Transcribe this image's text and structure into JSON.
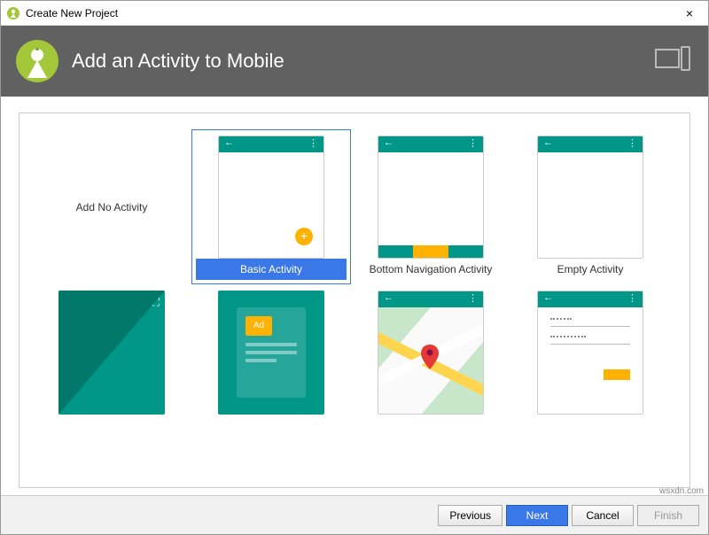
{
  "window": {
    "title": "Create New Project",
    "close": "×"
  },
  "header": {
    "title": "Add an Activity to Mobile"
  },
  "activities": [
    {
      "id": "none",
      "label": "Add No Activity"
    },
    {
      "id": "basic",
      "label": "Basic Activity",
      "selected": true
    },
    {
      "id": "bottom_nav",
      "label": "Bottom Navigation Activity"
    },
    {
      "id": "empty",
      "label": "Empty Activity"
    },
    {
      "id": "fullscreen",
      "label": ""
    },
    {
      "id": "ad",
      "label": ""
    },
    {
      "id": "maps",
      "label": ""
    },
    {
      "id": "login",
      "label": ""
    }
  ],
  "ad_text": "Ad",
  "footer": {
    "previous": "Previous",
    "next": "Next",
    "cancel": "Cancel",
    "finish": "Finish"
  },
  "watermark": "wsxdn.com",
  "colors": {
    "accent": "#3b78e7",
    "teal": "#009688",
    "amber": "#ffb300",
    "header": "#616161"
  }
}
